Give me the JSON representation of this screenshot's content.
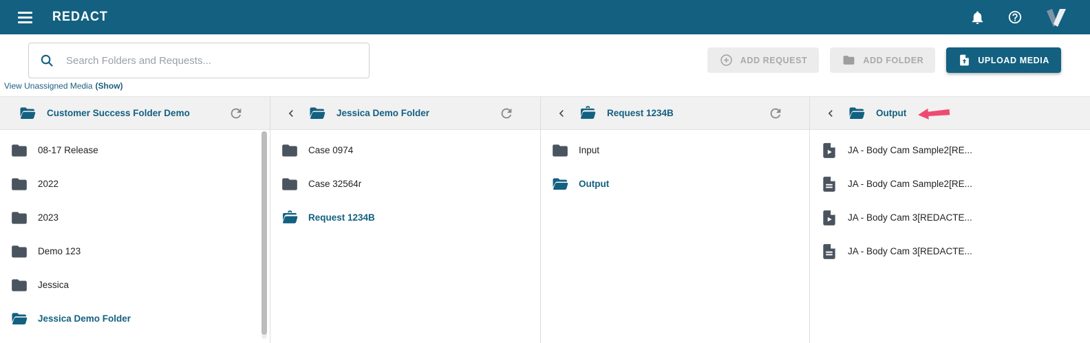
{
  "app": {
    "colors": {
      "primary_teal": "#136080",
      "slate_icon": "#4A545E",
      "annotation_pink": "#EF4B72",
      "disabled_button_bg": "#ECECEC",
      "column_header_bg": "#F1F1F1"
    }
  },
  "header": {
    "title": "REDACT",
    "icons": [
      "menu-icon",
      "notifications-bell-icon",
      "help-icon",
      "veritone-logo"
    ]
  },
  "toolbar": {
    "search": {
      "placeholder": "Search Folders and Requests...",
      "icon": "search-icon"
    },
    "buttons": [
      {
        "label": "ADD REQUEST",
        "icon": "add-circle-icon",
        "enabled": false
      },
      {
        "label": "ADD FOLDER",
        "icon": "folder-icon",
        "enabled": false
      },
      {
        "label": "UPLOAD MEDIA",
        "icon": "upload-file-icon",
        "enabled": true
      }
    ],
    "unassigned_media": {
      "prefix": "View Unassigned Media",
      "action": "(Show)"
    }
  },
  "browser": {
    "columns": [
      {
        "title": "Customer Success Folder Demo",
        "icon": "folder-open",
        "has_back": false,
        "has_refresh": true,
        "has_scrollbar": true,
        "items": [
          {
            "label": "08-17 Release",
            "icon": "folder",
            "selected": false
          },
          {
            "label": "2022",
            "icon": "folder",
            "selected": false
          },
          {
            "label": "2023",
            "icon": "folder",
            "selected": false
          },
          {
            "label": "Demo 123",
            "icon": "folder",
            "selected": false
          },
          {
            "label": "Jessica",
            "icon": "folder",
            "selected": false
          },
          {
            "label": "Jessica Demo Folder",
            "icon": "folder-open",
            "selected": true
          }
        ]
      },
      {
        "title": "Jessica Demo Folder",
        "icon": "folder-open",
        "has_back": true,
        "has_refresh": true,
        "has_scrollbar": false,
        "items": [
          {
            "label": "Case 0974",
            "icon": "folder",
            "selected": false
          },
          {
            "label": "Case 32564r",
            "icon": "folder",
            "selected": false
          },
          {
            "label": "Request 1234B",
            "icon": "briefcase-open",
            "selected": true
          }
        ]
      },
      {
        "title": "Request 1234B",
        "icon": "briefcase-open",
        "has_back": true,
        "has_refresh": true,
        "has_scrollbar": false,
        "items": [
          {
            "label": "Input",
            "icon": "folder",
            "selected": false
          },
          {
            "label": "Output",
            "icon": "folder-open",
            "selected": true
          }
        ]
      },
      {
        "title": "Output",
        "icon": "folder-open",
        "has_back": true,
        "has_refresh": false,
        "has_scrollbar": false,
        "annotation": {
          "type": "left-arrow",
          "color": "#EF4B72"
        },
        "items": [
          {
            "label": "JA - Body Cam Sample2[RE...",
            "icon": "video-file",
            "selected": false
          },
          {
            "label": "JA - Body Cam Sample2[RE...",
            "icon": "doc-file",
            "selected": false
          },
          {
            "label": "JA - Body Cam 3[REDACTE...",
            "icon": "video-file",
            "selected": false
          },
          {
            "label": "JA - Body Cam 3[REDACTE...",
            "icon": "doc-file",
            "selected": false
          }
        ]
      }
    ]
  }
}
